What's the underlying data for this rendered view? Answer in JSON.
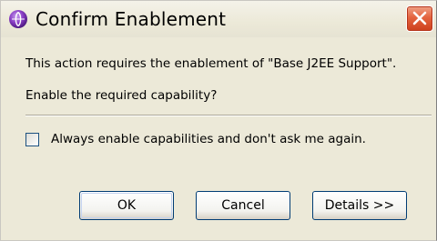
{
  "dialog": {
    "title": "Confirm Enablement",
    "title_icon": "eclipse-icon",
    "close_icon": "close-icon",
    "message_line1": "This action requires the enablement of \"Base J2EE Support\".",
    "message_line2": "Enable the required capability?",
    "checkbox": {
      "label": "Always enable capabilities and don't ask me again.",
      "checked": false
    },
    "buttons": {
      "ok": "OK",
      "cancel": "Cancel",
      "details": "Details >>"
    }
  },
  "colors": {
    "dialog_background": "#ece9d8",
    "close_button": "#e4643f",
    "button_border": "#003c74",
    "title_icon": "#8b3fc6"
  }
}
